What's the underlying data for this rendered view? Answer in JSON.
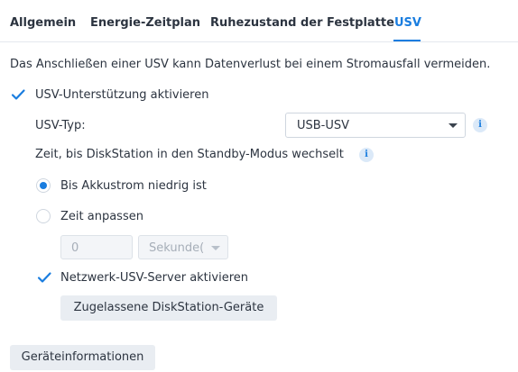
{
  "tabs": [
    {
      "label": "Allgemein",
      "active": false
    },
    {
      "label": "Energie-Zeitplan",
      "active": false
    },
    {
      "label": "Ruhezustand der Festplatte",
      "active": false
    },
    {
      "label": "USV",
      "active": true
    }
  ],
  "description": "Das Anschließen einer USV kann Datenverlust bei einem Stromausfall vermeiden.",
  "ups_support": {
    "label": "USV-Unterstützung aktivieren",
    "checked": true
  },
  "ups_type": {
    "label": "USV-Typ:",
    "value": "USB-USV"
  },
  "standby": {
    "label": "Zeit, bis DiskStation in den Standby-Modus wechselt",
    "option_low_battery": {
      "label": "Bis Akkustrom niedrig ist",
      "selected": true
    },
    "option_custom_time": {
      "label": "Zeit anpassen",
      "selected": false
    },
    "time_value": "0",
    "time_unit": "Sekunde("
  },
  "network_server": {
    "label": "Netzwerk-USV-Server aktivieren",
    "checked": true
  },
  "allowed_devices_button": "Zugelassene DiskStation-Geräte",
  "device_info_button": "Geräteinformationen",
  "colors": {
    "accent": "#1a7ddf",
    "text": "#2c3440",
    "button_bg": "#e9edf2"
  },
  "icons": {
    "info": "info-icon",
    "check": "checkmark-icon",
    "dropdown": "chevron-down-icon"
  }
}
